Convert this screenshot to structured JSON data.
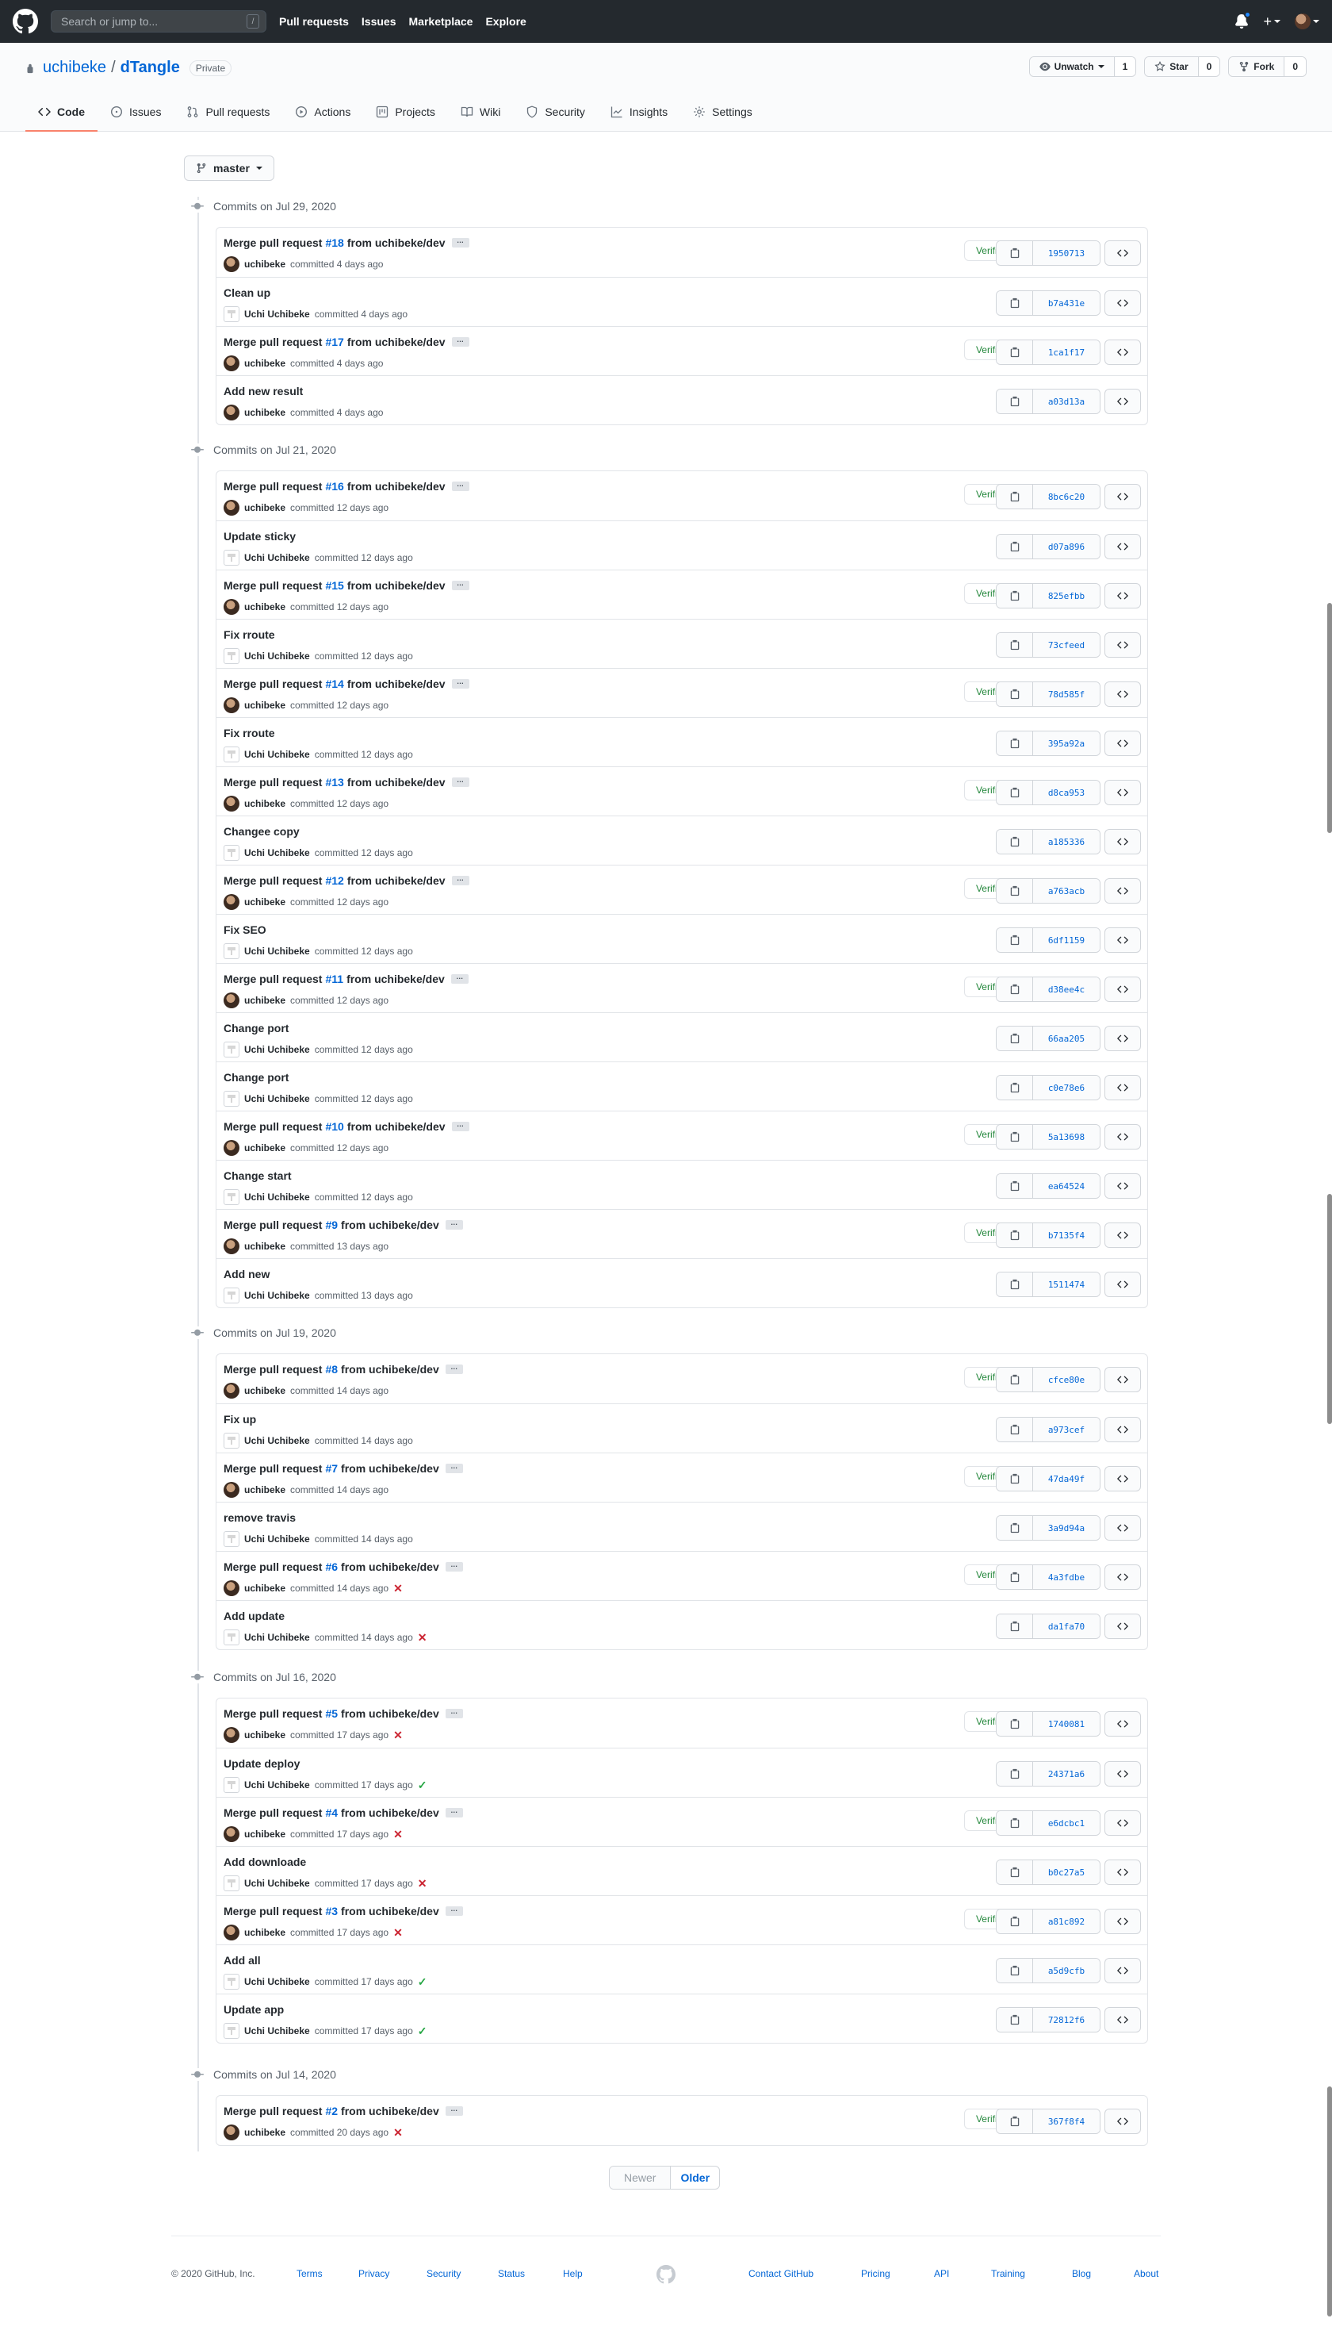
{
  "header": {
    "search_placeholder": "Search or jump to...",
    "search_key": "/",
    "nav": [
      "Pull requests",
      "Issues",
      "Marketplace",
      "Explore"
    ]
  },
  "repo": {
    "owner": "uchibeke",
    "name": "dTangle",
    "visibility": "Private",
    "watch_label": "Unwatch",
    "watch_count": "1",
    "star_label": "Star",
    "star_count": "0",
    "fork_label": "Fork",
    "fork_count": "0",
    "tabs": [
      "Code",
      "Issues",
      "Pull requests",
      "Actions",
      "Projects",
      "Wiki",
      "Security",
      "Insights",
      "Settings"
    ]
  },
  "branch": "master",
  "commit_groups": [
    {
      "date_label": "Commits on Jul 29, 2020",
      "commits": [
        {
          "kind": "pr",
          "pre": "Merge pull request",
          "pr": "#18",
          "post": "from uchibeke/dev",
          "author": "uchibeke",
          "avatar": "photo",
          "when": "committed 4 days ago",
          "status": "",
          "verified": "Verified",
          "sha": "1950713"
        },
        {
          "kind": "plain",
          "title": "Clean up",
          "author": "Uchi Uchibeke",
          "avatar": "identicon",
          "when": "committed 4 days ago",
          "status": "",
          "verified": "",
          "sha": "b7a431e"
        },
        {
          "kind": "pr",
          "pre": "Merge pull request",
          "pr": "#17",
          "post": "from uchibeke/dev",
          "author": "uchibeke",
          "avatar": "photo",
          "when": "committed 4 days ago",
          "status": "",
          "verified": "Verified",
          "sha": "1ca1f17"
        },
        {
          "kind": "plain",
          "title": "Add new result",
          "author": "uchibeke",
          "avatar": "photo",
          "when": "committed 4 days ago",
          "status": "",
          "verified": "",
          "sha": "a03d13a"
        }
      ]
    },
    {
      "date_label": "Commits on Jul 21, 2020",
      "commits": [
        {
          "kind": "pr",
          "pre": "Merge pull request",
          "pr": "#16",
          "post": "from uchibeke/dev",
          "author": "uchibeke",
          "avatar": "photo",
          "when": "committed 12 days ago",
          "status": "",
          "verified": "Verified",
          "sha": "8bc6c20"
        },
        {
          "kind": "plain",
          "title": "Update sticky",
          "author": "Uchi Uchibeke",
          "avatar": "identicon",
          "when": "committed 12 days ago",
          "status": "",
          "verified": "",
          "sha": "d07a896"
        },
        {
          "kind": "pr",
          "pre": "Merge pull request",
          "pr": "#15",
          "post": "from uchibeke/dev",
          "author": "uchibeke",
          "avatar": "photo",
          "when": "committed 12 days ago",
          "status": "",
          "verified": "Verified",
          "sha": "825efbb"
        },
        {
          "kind": "plain",
          "title": "Fix rroute",
          "author": "Uchi Uchibeke",
          "avatar": "identicon",
          "when": "committed 12 days ago",
          "status": "",
          "verified": "",
          "sha": "73cfeed"
        },
        {
          "kind": "pr",
          "pre": "Merge pull request",
          "pr": "#14",
          "post": "from uchibeke/dev",
          "author": "uchibeke",
          "avatar": "photo",
          "when": "committed 12 days ago",
          "status": "",
          "verified": "Verified",
          "sha": "78d585f"
        },
        {
          "kind": "plain",
          "title": "Fix rroute",
          "author": "Uchi Uchibeke",
          "avatar": "identicon",
          "when": "committed 12 days ago",
          "status": "",
          "verified": "",
          "sha": "395a92a"
        },
        {
          "kind": "pr",
          "pre": "Merge pull request",
          "pr": "#13",
          "post": "from uchibeke/dev",
          "author": "uchibeke",
          "avatar": "photo",
          "when": "committed 12 days ago",
          "status": "",
          "verified": "Verified",
          "sha": "d8ca953"
        },
        {
          "kind": "plain",
          "title": "Changee copy",
          "author": "Uchi Uchibeke",
          "avatar": "identicon",
          "when": "committed 12 days ago",
          "status": "",
          "verified": "",
          "sha": "a185336"
        },
        {
          "kind": "pr",
          "pre": "Merge pull request",
          "pr": "#12",
          "post": "from uchibeke/dev",
          "author": "uchibeke",
          "avatar": "photo",
          "when": "committed 12 days ago",
          "status": "",
          "verified": "Verified",
          "sha": "a763acb"
        },
        {
          "kind": "plain",
          "title": "Fix SEO",
          "author": "Uchi Uchibeke",
          "avatar": "identicon",
          "when": "committed 12 days ago",
          "status": "",
          "verified": "",
          "sha": "6df1159"
        },
        {
          "kind": "pr",
          "pre": "Merge pull request",
          "pr": "#11",
          "post": "from uchibeke/dev",
          "author": "uchibeke",
          "avatar": "photo",
          "when": "committed 12 days ago",
          "status": "",
          "verified": "Verified",
          "sha": "d38ee4c"
        },
        {
          "kind": "plain",
          "title": "Change port",
          "author": "Uchi Uchibeke",
          "avatar": "identicon",
          "when": "committed 12 days ago",
          "status": "",
          "verified": "",
          "sha": "66aa205"
        },
        {
          "kind": "plain",
          "title": "Change port",
          "author": "Uchi Uchibeke",
          "avatar": "identicon",
          "when": "committed 12 days ago",
          "status": "",
          "verified": "",
          "sha": "c0e78e6"
        },
        {
          "kind": "pr",
          "pre": "Merge pull request",
          "pr": "#10",
          "post": "from uchibeke/dev",
          "author": "uchibeke",
          "avatar": "photo",
          "when": "committed 12 days ago",
          "status": "",
          "verified": "Verified",
          "sha": "5a13698"
        },
        {
          "kind": "plain",
          "title": "Change start",
          "author": "Uchi Uchibeke",
          "avatar": "identicon",
          "when": "committed 12 days ago",
          "status": "",
          "verified": "",
          "sha": "ea64524"
        },
        {
          "kind": "pr",
          "pre": "Merge pull request",
          "pr": "#9",
          "post": "from uchibeke/dev",
          "author": "uchibeke",
          "avatar": "photo",
          "when": "committed 13 days ago",
          "status": "",
          "verified": "Verified",
          "sha": "b7135f4"
        },
        {
          "kind": "plain",
          "title": "Add new",
          "author": "Uchi Uchibeke",
          "avatar": "identicon",
          "when": "committed 13 days ago",
          "status": "",
          "verified": "",
          "sha": "1511474"
        }
      ]
    },
    {
      "date_label": "Commits on Jul 19, 2020",
      "commits": [
        {
          "kind": "pr",
          "pre": "Merge pull request",
          "pr": "#8",
          "post": "from uchibeke/dev",
          "author": "uchibeke",
          "avatar": "photo",
          "when": "committed 14 days ago",
          "status": "",
          "verified": "Verified",
          "sha": "cfce80e"
        },
        {
          "kind": "plain",
          "title": "Fix up",
          "author": "Uchi Uchibeke",
          "avatar": "identicon",
          "when": "committed 14 days ago",
          "status": "",
          "verified": "",
          "sha": "a973cef"
        },
        {
          "kind": "pr",
          "pre": "Merge pull request",
          "pr": "#7",
          "post": "from uchibeke/dev",
          "author": "uchibeke",
          "avatar": "photo",
          "when": "committed 14 days ago",
          "status": "",
          "verified": "Verified",
          "sha": "47da49f"
        },
        {
          "kind": "plain",
          "title": "remove travis",
          "author": "Uchi Uchibeke",
          "avatar": "identicon",
          "when": "committed 14 days ago",
          "status": "",
          "verified": "",
          "sha": "3a9d94a"
        },
        {
          "kind": "pr",
          "pre": "Merge pull request",
          "pr": "#6",
          "post": "from uchibeke/dev",
          "author": "uchibeke",
          "avatar": "photo",
          "when": "committed 14 days ago",
          "status": "fail",
          "verified": "Verified",
          "sha": "4a3fdbe"
        },
        {
          "kind": "plain",
          "title": "Add update",
          "author": "Uchi Uchibeke",
          "avatar": "identicon",
          "when": "committed 14 days ago",
          "status": "fail",
          "verified": "",
          "sha": "da1fa70"
        }
      ]
    },
    {
      "date_label": "Commits on Jul 16, 2020",
      "commits": [
        {
          "kind": "pr",
          "pre": "Merge pull request",
          "pr": "#5",
          "post": "from uchibeke/dev",
          "author": "uchibeke",
          "avatar": "photo",
          "when": "committed 17 days ago",
          "status": "fail",
          "verified": "Verified",
          "sha": "1740081"
        },
        {
          "kind": "plain",
          "title": "Update deploy",
          "author": "Uchi Uchibeke",
          "avatar": "identicon",
          "when": "committed 17 days ago",
          "status": "pass",
          "verified": "",
          "sha": "24371a6"
        },
        {
          "kind": "pr",
          "pre": "Merge pull request",
          "pr": "#4",
          "post": "from uchibeke/dev",
          "author": "uchibeke",
          "avatar": "photo",
          "when": "committed 17 days ago",
          "status": "fail",
          "verified": "Verified",
          "sha": "e6dcbc1"
        },
        {
          "kind": "plain",
          "title": "Add downloade",
          "author": "Uchi Uchibeke",
          "avatar": "identicon",
          "when": "committed 17 days ago",
          "status": "fail",
          "verified": "",
          "sha": "b0c27a5"
        },
        {
          "kind": "pr",
          "pre": "Merge pull request",
          "pr": "#3",
          "post": "from uchibeke/dev",
          "author": "uchibeke",
          "avatar": "photo",
          "when": "committed 17 days ago",
          "status": "fail",
          "verified": "Verified",
          "sha": "a81c892"
        },
        {
          "kind": "plain",
          "title": "Add all",
          "author": "Uchi Uchibeke",
          "avatar": "identicon",
          "when": "committed 17 days ago",
          "status": "pass",
          "verified": "",
          "sha": "a5d9cfb"
        },
        {
          "kind": "plain",
          "title": "Update app",
          "author": "Uchi Uchibeke",
          "avatar": "identicon",
          "when": "committed 17 days ago",
          "status": "pass",
          "verified": "",
          "sha": "72812f6"
        }
      ]
    },
    {
      "date_label": "Commits on Jul 14, 2020",
      "commits": [
        {
          "kind": "pr",
          "pre": "Merge pull request",
          "pr": "#2",
          "post": "from uchibeke/dev",
          "author": "uchibeke",
          "avatar": "photo",
          "when": "committed 20 days ago",
          "status": "fail",
          "verified": "Verified",
          "sha": "367f8f4"
        }
      ]
    }
  ],
  "status_glyphs": {
    "fail": "✕",
    "pass": "✓"
  },
  "pagination": {
    "newer": "Newer",
    "older": "Older"
  },
  "footer": {
    "copyright": "© 2020 GitHub, Inc.",
    "left_links": [
      "Terms",
      "Privacy",
      "Security",
      "Status",
      "Help"
    ],
    "right_links": [
      "Contact GitHub",
      "Pricing",
      "API",
      "Training",
      "Blog",
      "About"
    ]
  },
  "colors": {
    "accent": "#0366d6",
    "verified": "#22863a",
    "fail": "#cb2431",
    "pass": "#28a745",
    "tab_active": "#f9826c",
    "header": "#24292e"
  }
}
